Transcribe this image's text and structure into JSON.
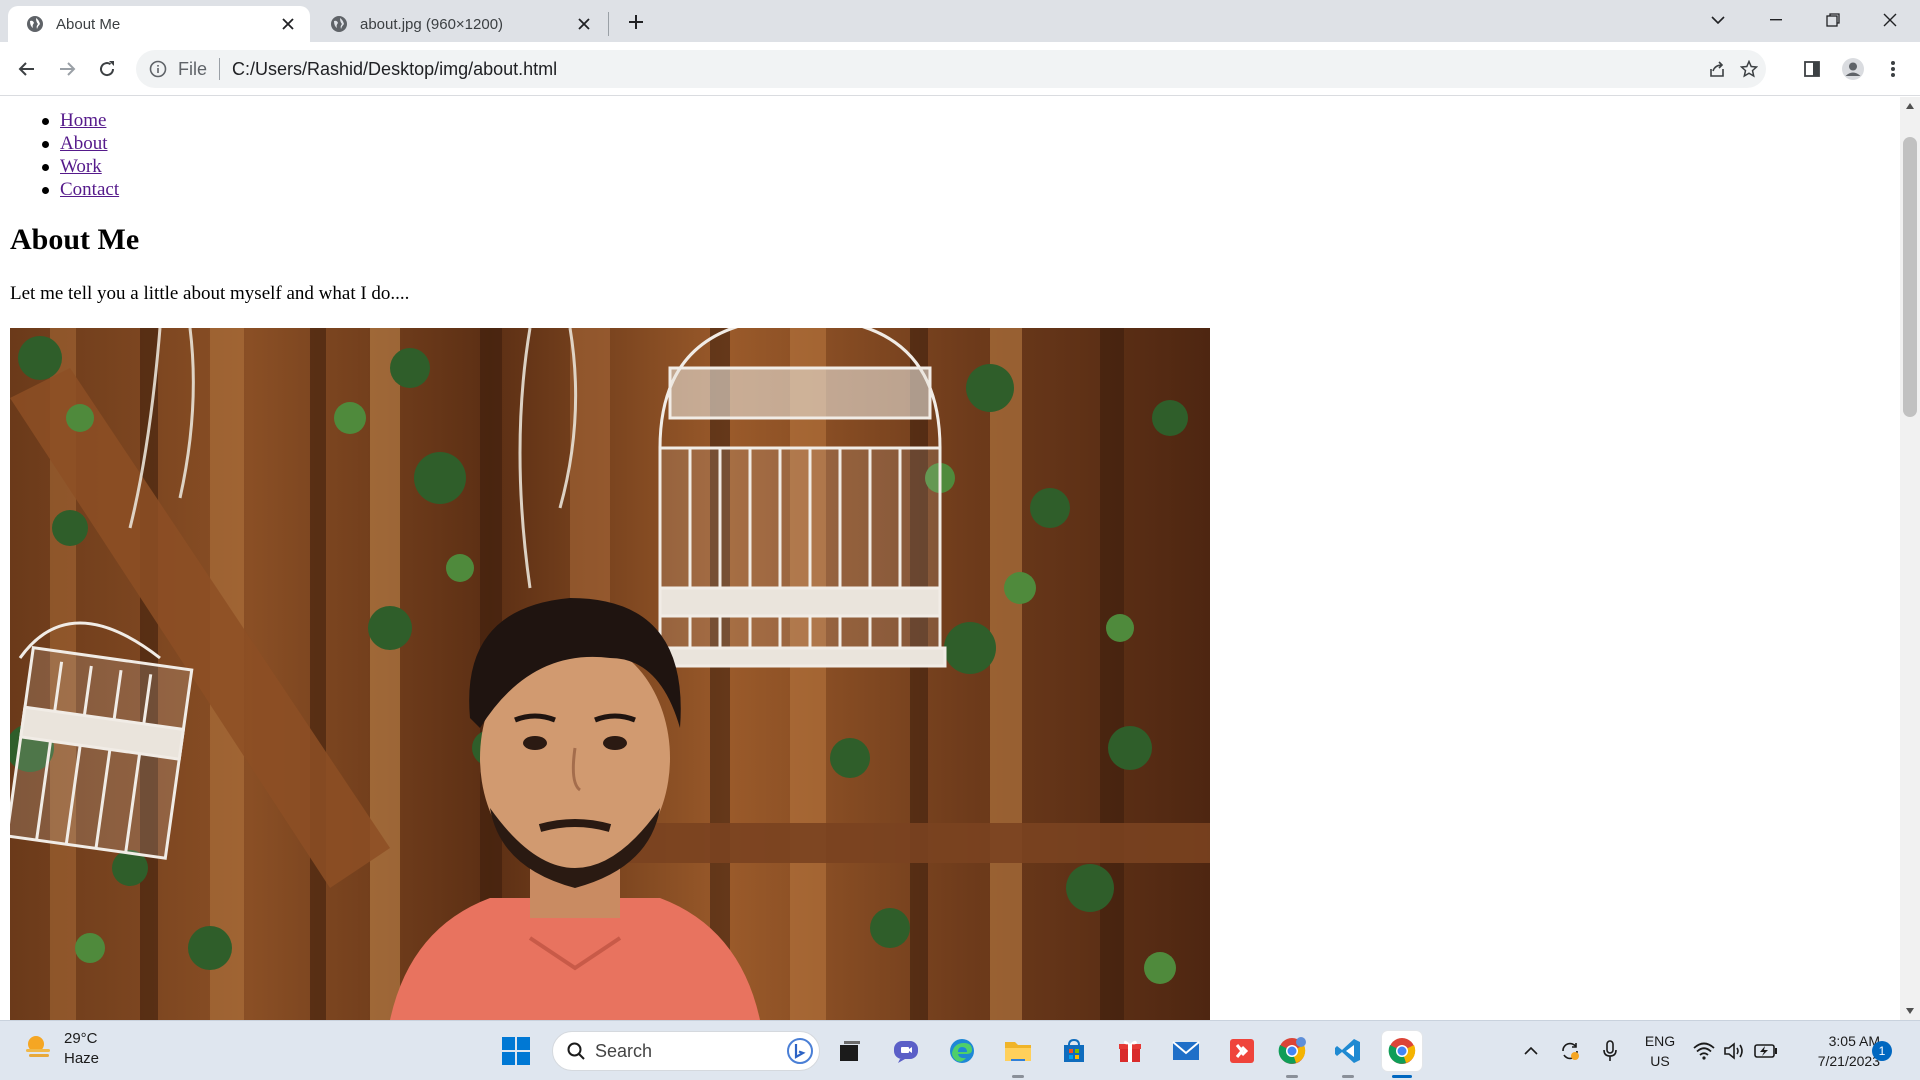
{
  "browser": {
    "tabs": [
      {
        "title": "About Me",
        "active": true
      },
      {
        "title": "about.jpg (960×1200)",
        "active": false
      }
    ],
    "address": {
      "scheme_label": "File",
      "url": "C:/Users/Rashid/Desktop/img/about.html"
    }
  },
  "page": {
    "nav": [
      "Home",
      "About",
      "Work",
      "Contact"
    ],
    "heading": "About Me",
    "intro": "Let me tell you a little about myself and what I do....",
    "image_alt": "about.jpg"
  },
  "taskbar": {
    "weather": {
      "temp": "29°C",
      "condition": "Haze"
    },
    "search_label": "Search",
    "language": {
      "line1": "ENG",
      "line2": "US"
    },
    "clock": {
      "time": "3:05 AM",
      "date": "7/21/2023"
    },
    "notification_count": "1"
  },
  "colors": {
    "titlebar": "#dee1e6",
    "link_visited": "#551a8b",
    "taskbar": "#dfe6ef",
    "accent": "#0067c0"
  }
}
